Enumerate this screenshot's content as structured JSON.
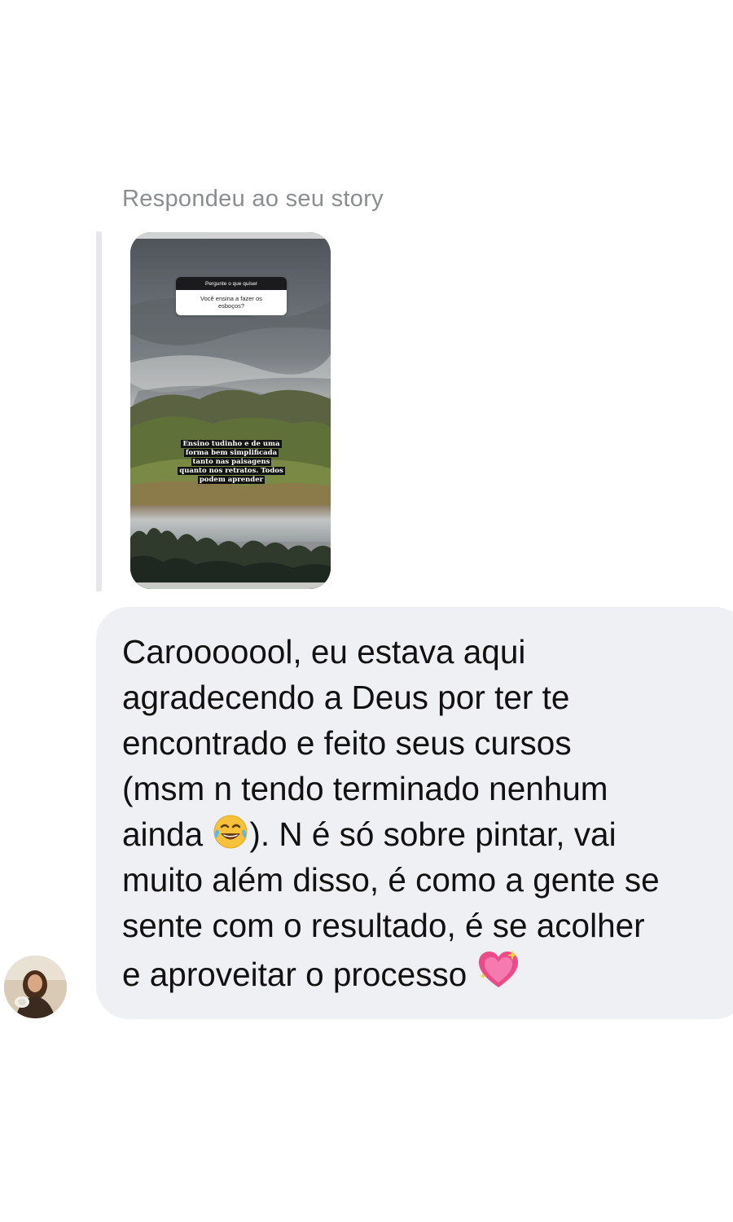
{
  "reply": {
    "label": "Respondeu ao seu story"
  },
  "story": {
    "question_header": "Pergunte o que quiser",
    "question_text": "Você ensina a fazer os esboços?",
    "answer_lines": [
      "Ensino tudinho e de uma",
      "forma bem simplificada",
      "tanto nas paisagens",
      "quanto nos retratos. Todos",
      "podem aprender"
    ]
  },
  "message": {
    "lines": [
      "Carooooool, eu estava aqui",
      "agradecendo a Deus por ter te",
      "encontrado e feito seus cursos",
      "(msm n tendo terminado nenhum",
      "ainda ",
      "). N é só sobre pintar, vai",
      "muito além disso, é como a gente se",
      "sente com o resultado, é se acolher",
      "e aproveitar o processo "
    ],
    "emojis": [
      "face-with-tears-of-joy-icon",
      "sparkling-heart-icon"
    ]
  },
  "colors": {
    "bubble": "#eff0f3",
    "label": "#8a8d91",
    "text": "#111111"
  }
}
